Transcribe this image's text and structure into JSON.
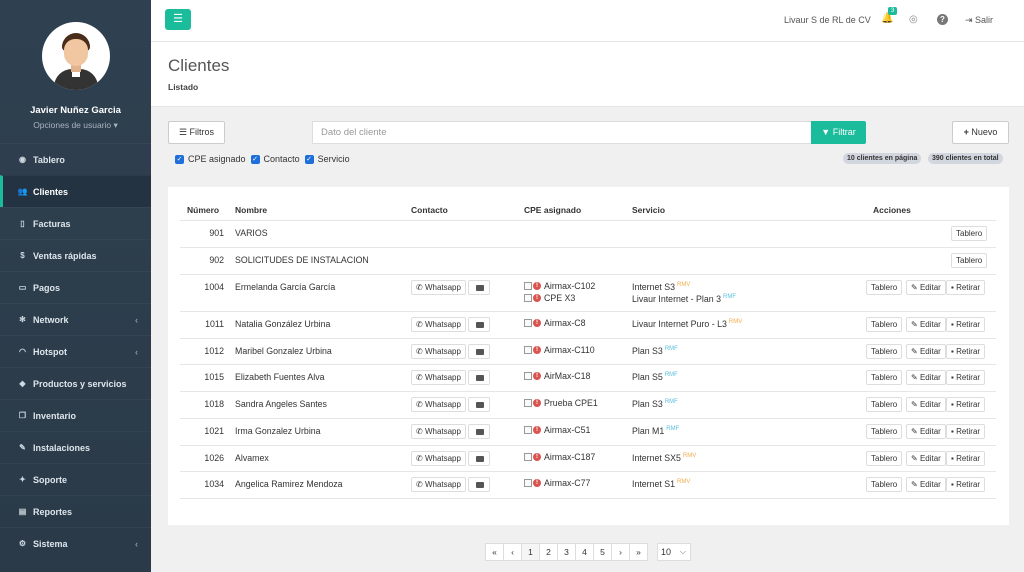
{
  "user": {
    "name": "Javier Nuñez Garcia",
    "options_label": "Opciones de usuario"
  },
  "nav": [
    {
      "label": "Tablero",
      "icon": "dashboard-icon"
    },
    {
      "label": "Clientes",
      "icon": "users-icon"
    },
    {
      "label": "Facturas",
      "icon": "file-icon"
    },
    {
      "label": "Ventas rápidas",
      "icon": "dollar-icon"
    },
    {
      "label": "Pagos",
      "icon": "money-icon"
    },
    {
      "label": "Network",
      "icon": "snowflake-icon"
    },
    {
      "label": "Hotspot",
      "icon": "wifi-icon"
    },
    {
      "label": "Productos y servicios",
      "icon": "tags-icon"
    },
    {
      "label": "Inventario",
      "icon": "cubes-icon"
    },
    {
      "label": "Instalaciones",
      "icon": "wrench-icon"
    },
    {
      "label": "Soporte",
      "icon": "support-icon"
    },
    {
      "label": "Reportes",
      "icon": "report-icon"
    },
    {
      "label": "Sistema",
      "icon": "cogs-icon"
    }
  ],
  "topbar": {
    "company": "Livaur S de RL de CV",
    "notifications": "3",
    "logout": "Salir"
  },
  "page": {
    "title": "Clientes",
    "subtitle": "Listado"
  },
  "filters": {
    "filtros_label": "Filtros",
    "search_placeholder": "Dato del cliente",
    "filtrar_label": "Filtrar",
    "nuevo_label": "Nuevo",
    "checks": [
      "CPE asignado",
      "Contacto",
      "Servicio"
    ],
    "page_count": "10 clientes en página",
    "total_count": "390 clientes en total"
  },
  "table": {
    "headers": [
      "Número",
      "Nombre",
      "Contacto",
      "CPE asignado",
      "Servicio",
      "Acciones"
    ],
    "whatsapp_label": "Whatsapp",
    "tablero_label": "Tablero",
    "editar_label": "Editar",
    "retirar_label": "Retirar",
    "rows": [
      {
        "numero": "901",
        "nombre": "VARIOS"
      },
      {
        "numero": "902",
        "nombre": "SOLICITUDES DE INSTALACION"
      },
      {
        "numero": "1004",
        "nombre": "Ermelanda García García",
        "cpe": [
          "Airmax-C102",
          "CPE X3"
        ],
        "servicio": [
          {
            "name": "Internet S3",
            "tag": "RMV"
          },
          {
            "name": "Livaur Internet - Plan 3",
            "tag": "RMF"
          }
        ]
      },
      {
        "numero": "1011",
        "nombre": "Natalia González Urbina",
        "cpe": [
          "Airmax-C8"
        ],
        "servicio": [
          {
            "name": "Livaur Internet Puro - L3",
            "tag": "RMV"
          }
        ]
      },
      {
        "numero": "1012",
        "nombre": "Maribel Gonzalez Urbina",
        "cpe": [
          "Airmax-C110"
        ],
        "servicio": [
          {
            "name": "Plan S3",
            "tag": "RMF"
          }
        ]
      },
      {
        "numero": "1015",
        "nombre": "Elizabeth Fuentes Alva",
        "cpe": [
          "AirMax-C18"
        ],
        "servicio": [
          {
            "name": "Plan S5",
            "tag": "RMF"
          }
        ]
      },
      {
        "numero": "1018",
        "nombre": "Sandra Angeles Santes",
        "cpe": [
          "Prueba CPE1"
        ],
        "servicio": [
          {
            "name": "Plan S3",
            "tag": "RMF"
          }
        ]
      },
      {
        "numero": "1021",
        "nombre": "Irma Gonzalez Urbina",
        "cpe": [
          "Airmax-C51"
        ],
        "servicio": [
          {
            "name": "Plan M1",
            "tag": "RMF"
          }
        ]
      },
      {
        "numero": "1026",
        "nombre": "Alvamex",
        "cpe": [
          "Airmax-C187"
        ],
        "servicio": [
          {
            "name": "Internet SX5",
            "tag": "RMV"
          }
        ]
      },
      {
        "numero": "1034",
        "nombre": "Angelica Ramirez Mendoza",
        "cpe": [
          "Airmax-C77"
        ],
        "servicio": [
          {
            "name": "Internet S1",
            "tag": "RMV"
          }
        ]
      }
    ]
  },
  "pagination": {
    "pages": [
      "«",
      "‹",
      "1",
      "2",
      "3",
      "4",
      "5",
      "›",
      "»"
    ],
    "current": "1",
    "page_size": "10"
  }
}
